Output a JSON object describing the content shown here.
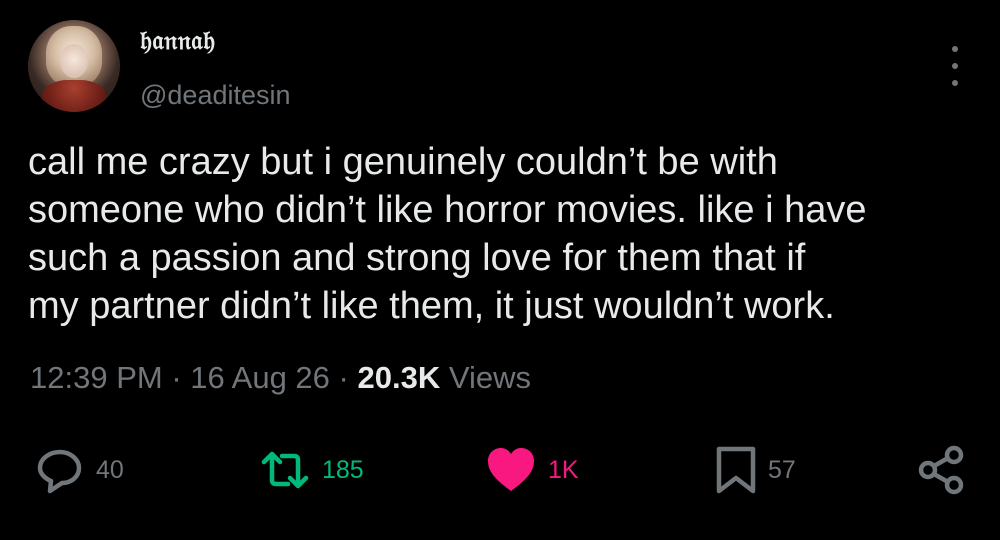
{
  "author": {
    "display_name": "𝔥𝔞𝔫𝔫𝔞𝔥",
    "handle": "@deaditesin",
    "avatar_icon": "avatar-photo"
  },
  "tweet": {
    "text": "call me crazy but i genuinely couldn’t be with\nsomeone who didn’t like horror movies. like i have\nsuch a passion and strong love for them that if\nmy partner didn’t like them, it just wouldn’t work.",
    "time": "12:39 PM",
    "date": "16 Aug 26",
    "separator": "·",
    "views_count": "20.3K",
    "views_label": "Views"
  },
  "actions": {
    "reply_count": "40",
    "retweet_count": "185",
    "like_count": "1K",
    "bookmark_count": "57"
  },
  "colors": {
    "background": "#000000",
    "text": "#e7e9ea",
    "secondary": "#71767b",
    "retweet": "#00ba7c",
    "like": "#f91880"
  },
  "icons": [
    "more-vertical-icon",
    "reply-icon",
    "retweet-icon",
    "heart-icon",
    "bookmark-icon",
    "share-icon"
  ]
}
